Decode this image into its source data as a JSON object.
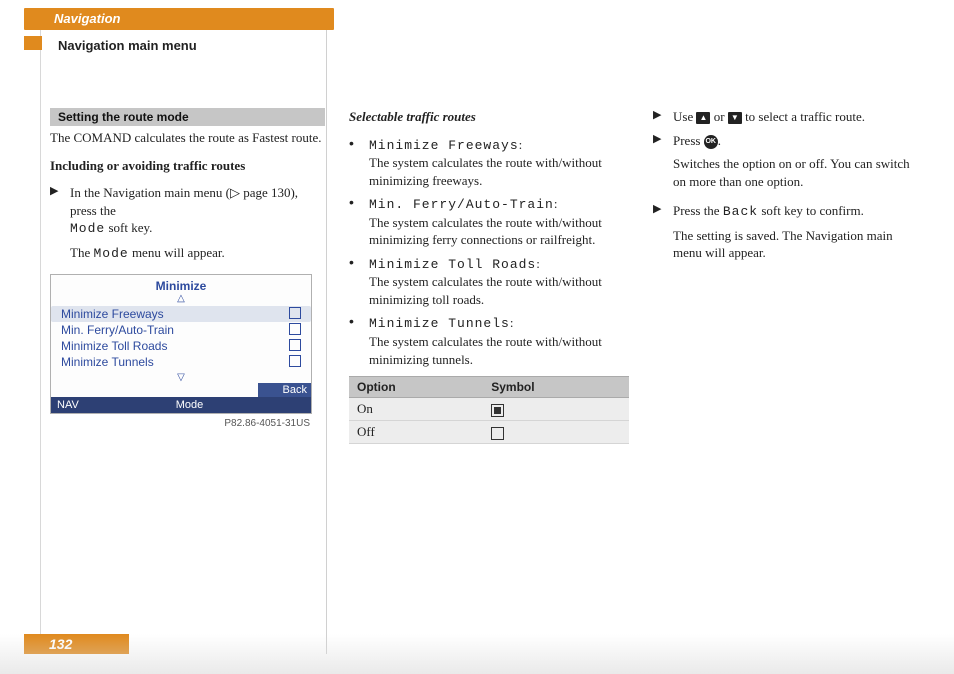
{
  "header": {
    "chapter": "Navigation",
    "section": "Navigation main menu"
  },
  "col1": {
    "subheader": "Setting the route mode",
    "intro1": "The COMAND calculates the route as Fastest route.",
    "intro2": "Including or avoiding traffic routes",
    "step1a": "In the Navigation main menu (",
    "step1_pageref": "page 130), press the",
    "step1_key": "Mode",
    "step1_suffix": " soft key.",
    "result_pre": "The ",
    "result_key": "Mode",
    "result_post": " menu will appear.",
    "screenshot": {
      "title": "Minimize",
      "items": [
        {
          "label": "Minimize Freeways",
          "selected": true
        },
        {
          "label": "Min. Ferry/Auto-Train",
          "selected": false
        },
        {
          "label": "Minimize Toll Roads",
          "selected": false
        },
        {
          "label": "Minimize Tunnels",
          "selected": false
        }
      ],
      "nav": "NAV",
      "mode": "Mode",
      "back": "Back",
      "caption": "P82.86-4051-31US"
    }
  },
  "col2": {
    "title": "Selectable traffic routes",
    "bullets": [
      {
        "key": "Minimize Freeways",
        "desc": "The system calculates the route with/without minimizing freeways."
      },
      {
        "key": "Min. Ferry/Auto-Train",
        "desc": "The system calculates the route with/without minimizing ferry connections or railfreight."
      },
      {
        "key": "Minimize Toll Roads",
        "desc": "The system calculates the route with/without minimizing toll roads."
      },
      {
        "key": "Minimize Tunnels",
        "desc": "The system calculates the route with/without minimizing tunnels."
      }
    ],
    "table": {
      "head_option": "Option",
      "head_symbol": "Symbol",
      "rows": [
        {
          "option": "On",
          "symbol": "on"
        },
        {
          "option": "Off",
          "symbol": "off"
        }
      ]
    }
  },
  "col3": {
    "s1_pre": "Use ",
    "s1_mid": " or ",
    "s1_post": " to select a traffic route.",
    "s2_pre": "Press ",
    "s2_ok": "OK",
    "s2_post": ".",
    "r2": "Switches the option on or off. You can switch on more than one option.",
    "s3_pre": "Press the ",
    "s3_key": "Back",
    "s3_post": " soft key to confirm.",
    "r3": "The setting is saved. The Navigation main menu will appear."
  },
  "page_number": "132"
}
